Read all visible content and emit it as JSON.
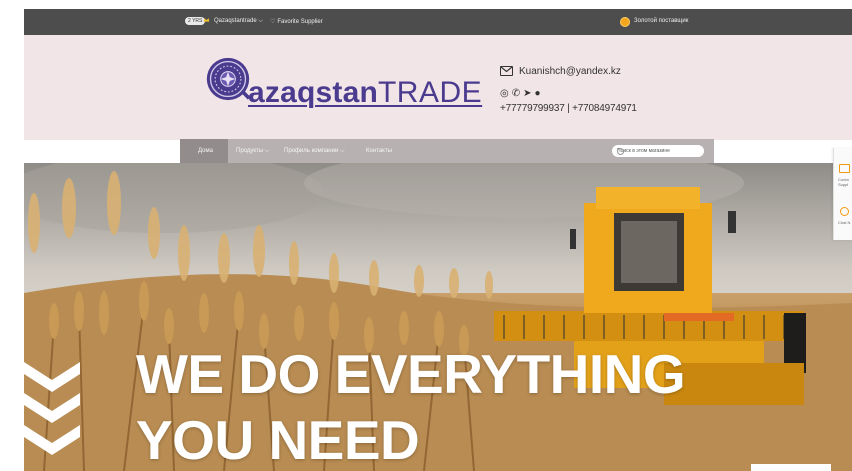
{
  "topbar": {
    "year_badge": "2 YRS",
    "store_name": "Qazaqstantrade",
    "store_chevron": "chevron-down-icon",
    "favorite_label": "Favorite Supplier",
    "gold_supplier_label": "Золотой поставщик",
    "colors": {
      "background": "#4d4d4d",
      "text": "#eeeeee",
      "gold": "#f4a51c"
    }
  },
  "header": {
    "logo_q": "Q",
    "logo_main": "azaqstan",
    "logo_trade": "TRADE",
    "logo_color": "#4a3b8f",
    "email": "Kuanishch@yandex.kz",
    "social_icons": [
      "whatsapp-icon",
      "viber-icon",
      "telegram-icon",
      "wechat-icon"
    ],
    "phones": "+77779799937  | +77084974971",
    "background": "#f1e5e7"
  },
  "nav": {
    "items": [
      {
        "label": "Дома",
        "active": true
      },
      {
        "label": "Продукты",
        "has_dropdown": true
      },
      {
        "label": "Профиль компании",
        "has_dropdown": true
      },
      {
        "label": "Контакты"
      }
    ],
    "search_placeholder": "Поиск в этом магазине",
    "background": "#b7b1b2",
    "active_background": "#938c8d"
  },
  "hero": {
    "line1": "WE DO EVERYTHING",
    "line2": "YOU NEED",
    "chevron_color": "#ffffff"
  },
  "side_widget": {
    "contact_label": "Conta Suppl",
    "chat_label": "Chat N",
    "accent": "#f29a0e"
  }
}
